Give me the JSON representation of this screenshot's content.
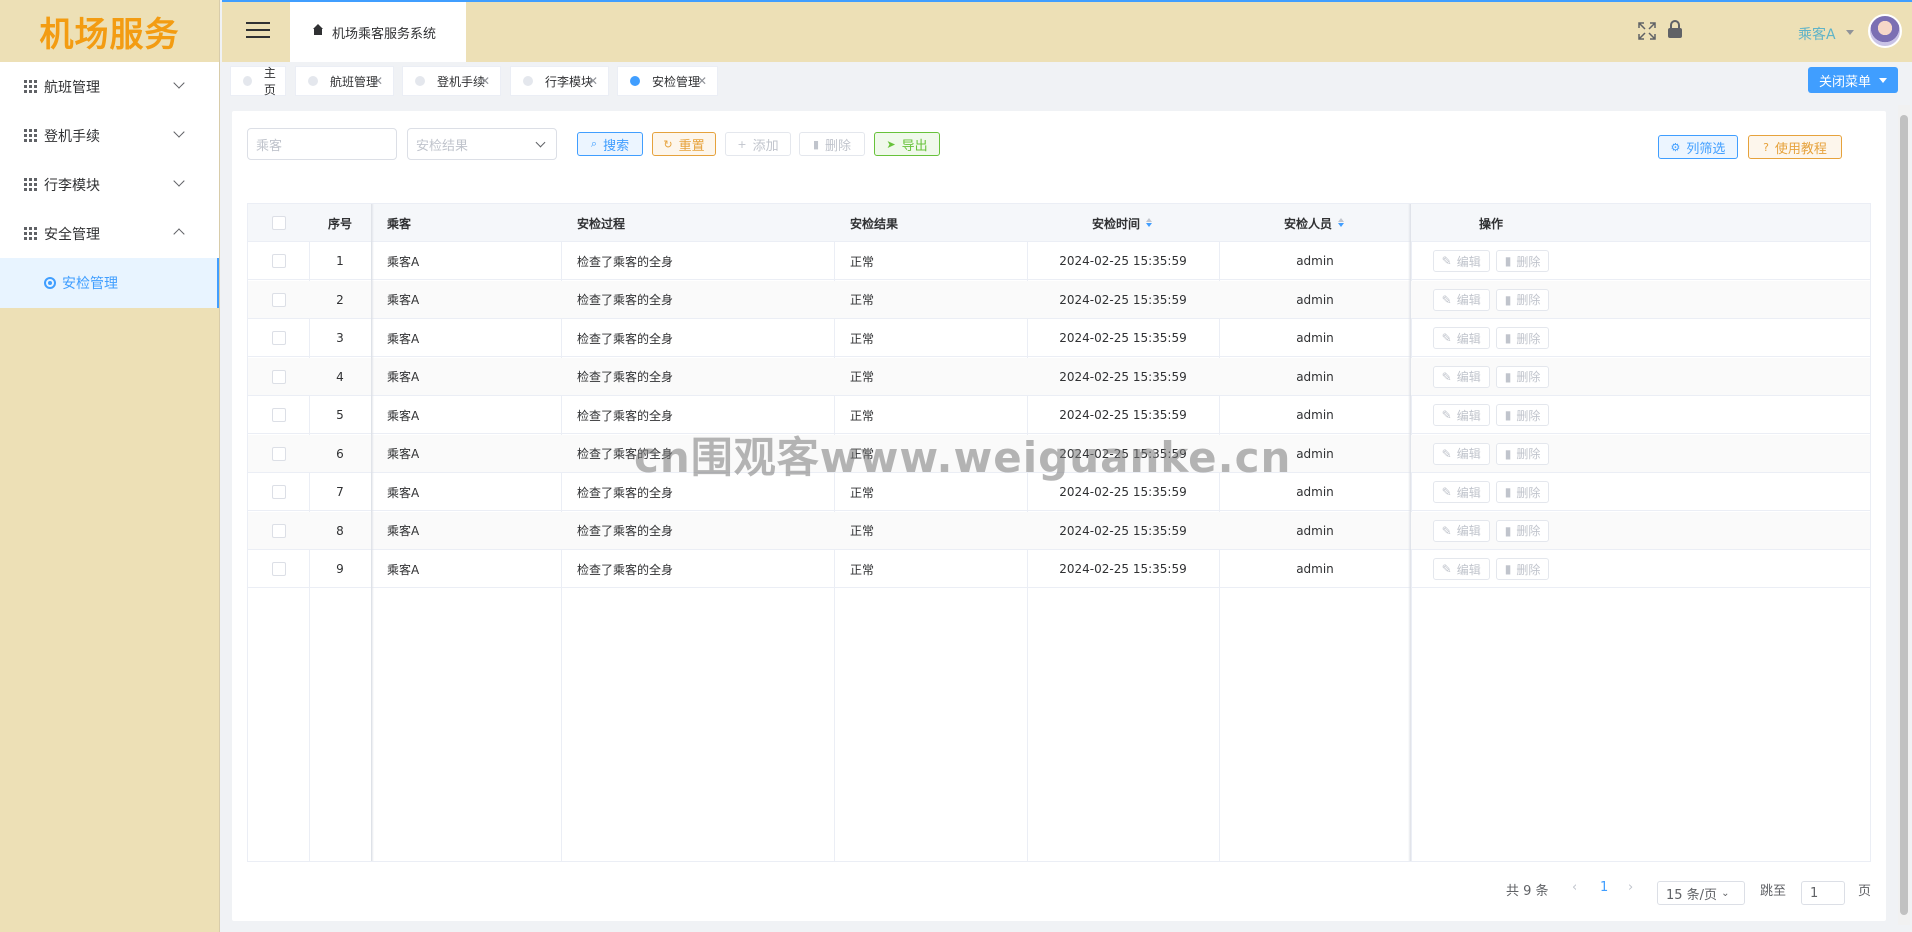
{
  "app": {
    "logo": "机场服务",
    "title": "机场乘客服务系统"
  },
  "user": {
    "name": "乘客A"
  },
  "sidebar": {
    "items": [
      {
        "label": "航班管理",
        "expanded": false
      },
      {
        "label": "登机手续",
        "expanded": false
      },
      {
        "label": "行李模块",
        "expanded": false
      },
      {
        "label": "安全管理",
        "expanded": true
      }
    ],
    "sub_item": "安检管理"
  },
  "tags": [
    {
      "label": "主页",
      "closable": false,
      "active": false
    },
    {
      "label": "航班管理",
      "closable": true,
      "active": false
    },
    {
      "label": "登机手续",
      "closable": true,
      "active": false
    },
    {
      "label": "行李模块",
      "closable": true,
      "active": false
    },
    {
      "label": "安检管理",
      "closable": true,
      "active": true
    }
  ],
  "close_menu_label": "关闭菜单",
  "toolbar": {
    "passenger_placeholder": "乘客",
    "result_placeholder": "安检结果",
    "search": "搜索",
    "reset": "重置",
    "add": "添加",
    "delete": "删除",
    "export": "导出",
    "column_filter": "列筛选",
    "tutorial": "使用教程"
  },
  "table": {
    "headers": [
      "序号",
      "乘客",
      "安检过程",
      "安检结果",
      "安检时间",
      "安检人员",
      "操作"
    ],
    "edit_label": "编辑",
    "delete_label": "删除",
    "rows": [
      {
        "no": "1",
        "passenger": "乘客A",
        "process": "检查了乘客的全身",
        "result": "正常",
        "time": "2024-02-25 15:35:59",
        "staff": "admin"
      },
      {
        "no": "2",
        "passenger": "乘客A",
        "process": "检查了乘客的全身",
        "result": "正常",
        "time": "2024-02-25 15:35:59",
        "staff": "admin"
      },
      {
        "no": "3",
        "passenger": "乘客A",
        "process": "检查了乘客的全身",
        "result": "正常",
        "time": "2024-02-25 15:35:59",
        "staff": "admin"
      },
      {
        "no": "4",
        "passenger": "乘客A",
        "process": "检查了乘客的全身",
        "result": "正常",
        "time": "2024-02-25 15:35:59",
        "staff": "admin"
      },
      {
        "no": "5",
        "passenger": "乘客A",
        "process": "检查了乘客的全身",
        "result": "正常",
        "time": "2024-02-25 15:35:59",
        "staff": "admin"
      },
      {
        "no": "6",
        "passenger": "乘客A",
        "process": "检查了乘客的全身",
        "result": "正常",
        "time": "2024-02-25 15:35:59",
        "staff": "admin"
      },
      {
        "no": "7",
        "passenger": "乘客A",
        "process": "检查了乘客的全身",
        "result": "正常",
        "time": "2024-02-25 15:35:59",
        "staff": "admin"
      },
      {
        "no": "8",
        "passenger": "乘客A",
        "process": "检查了乘客的全身",
        "result": "正常",
        "time": "2024-02-25 15:35:59",
        "staff": "admin"
      },
      {
        "no": "9",
        "passenger": "乘客A",
        "process": "检查了乘客的全身",
        "result": "正常",
        "time": "2024-02-25 15:35:59",
        "staff": "admin"
      }
    ]
  },
  "pagination": {
    "total": "共 9 条",
    "current_page": "1",
    "page_size": "15 条/页",
    "jump_label": "跳至",
    "jump_value": "1",
    "page_suffix": "页"
  },
  "watermark": "cn围观客www.weiguanke.cn",
  "colors": {
    "accent": "#409eff",
    "sidebar_bg": "#ede0b6",
    "logo": "#f39c12",
    "warning": "#e6a23c",
    "success": "#67c23a"
  }
}
